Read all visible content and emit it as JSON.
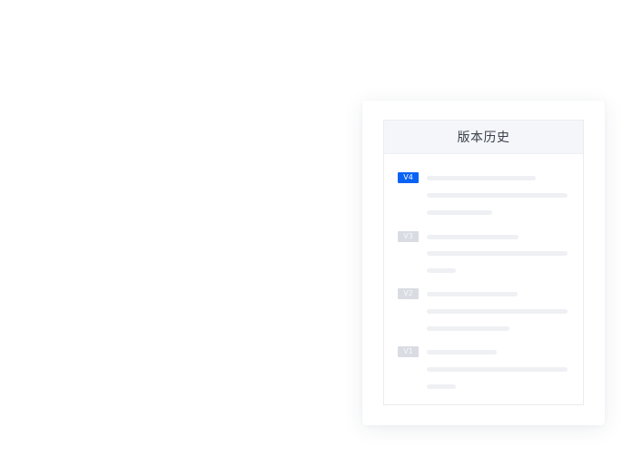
{
  "panel": {
    "title": "版本历史"
  },
  "versions": [
    {
      "label": "V4",
      "state": "active"
    },
    {
      "label": "V3",
      "state": "inactive"
    },
    {
      "label": "V2",
      "state": "inactive"
    },
    {
      "label": "V1",
      "state": "inactive"
    }
  ],
  "colors": {
    "accent": "#0b63f6",
    "inactive_badge": "#d9dce2",
    "placeholder_line": "#eef0f3",
    "header_bg": "#f4f6f9"
  }
}
